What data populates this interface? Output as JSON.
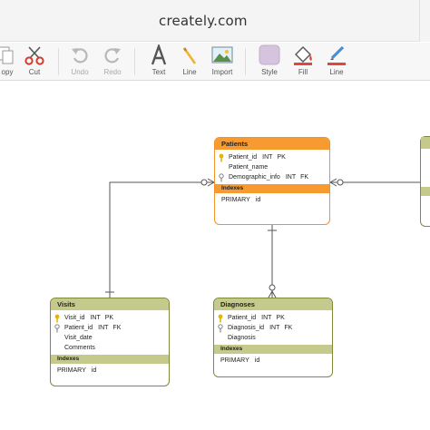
{
  "window": {
    "title": "creately.com"
  },
  "toolbar": {
    "copy_label": "opy",
    "cut_label": "Cut",
    "undo_label": "Undo",
    "redo_label": "Redo",
    "text_label": "Text",
    "line_label": "Line",
    "import_label": "Import",
    "style_label": "Style",
    "fill_label": "Fill",
    "line_color_label": "Line"
  },
  "icons": {
    "copy": "copy-icon",
    "cut": "scissors-icon",
    "undo": "undo-icon",
    "redo": "redo-icon",
    "text": "text-a-icon",
    "line": "pencil-line-icon",
    "import": "image-import-icon",
    "style": "style-swatch-icon",
    "fill": "paint-bucket-icon",
    "line_color": "pen-color-icon",
    "primary_key": "key-icon",
    "foreign_key": "key-outline-icon"
  },
  "colors": {
    "highlight_header": "#f79a2f",
    "highlight_border": "#f0922a",
    "entity_header": "#c5c98c",
    "entity_border": "#7d8a3a",
    "connector": "#555555",
    "key_primary": "#e8b400"
  },
  "entities": {
    "patients": {
      "title": "Patients",
      "fields": [
        {
          "name": "Patient_id",
          "type": "INT",
          "key": "PK",
          "icon": "key-icon"
        },
        {
          "name": "Patient_name",
          "type": "",
          "key": "",
          "icon": ""
        },
        {
          "name": "Demographic_info",
          "type": "INT",
          "key": "FK",
          "icon": "key-outline-icon"
        }
      ],
      "indexes_label": "Indexes",
      "indexes": [
        {
          "type": "PRIMARY",
          "column": "id"
        }
      ]
    },
    "visits": {
      "title": "Visits",
      "fields": [
        {
          "name": "Visit_id",
          "type": "INT",
          "key": "PK",
          "icon": "key-icon"
        },
        {
          "name": "Patient_id",
          "type": "INT",
          "key": "FK",
          "icon": "key-outline-icon"
        },
        {
          "name": "Visit_date",
          "type": "",
          "key": "",
          "icon": ""
        },
        {
          "name": "Comments",
          "type": "",
          "key": "",
          "icon": ""
        }
      ],
      "indexes_label": "Indexes",
      "indexes": [
        {
          "type": "PRIMARY",
          "column": "id"
        }
      ]
    },
    "diagnoses": {
      "title": "Diagnoses",
      "fields": [
        {
          "name": "Patient_id",
          "type": "INT",
          "key": "PK",
          "icon": "key-icon"
        },
        {
          "name": "Diagnosis_id",
          "type": "INT",
          "key": "FK",
          "icon": "key-outline-icon"
        },
        {
          "name": "Diagnosis",
          "type": "",
          "key": "",
          "icon": ""
        }
      ],
      "indexes_label": "Indexes",
      "indexes": [
        {
          "type": "PRIMARY",
          "column": "id"
        }
      ]
    }
  }
}
